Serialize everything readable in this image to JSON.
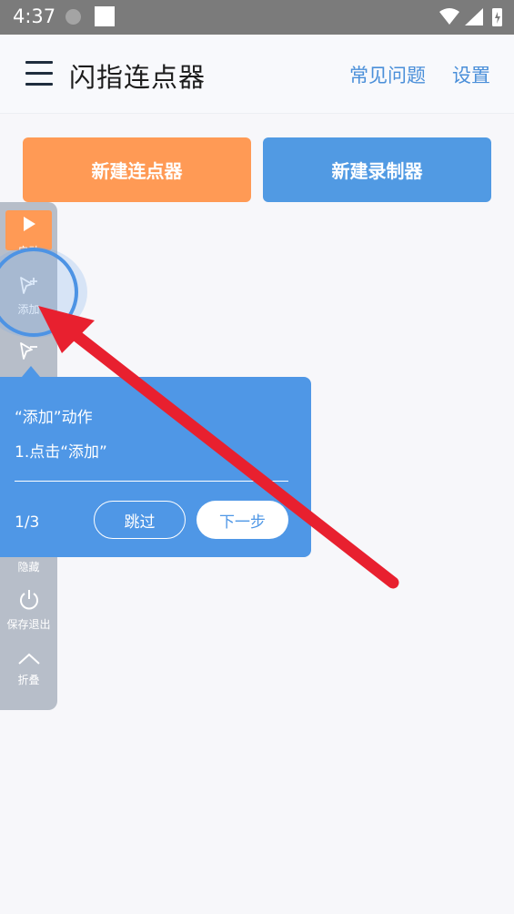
{
  "status_bar": {
    "time": "4:37"
  },
  "app_bar": {
    "title": "闪指连点器",
    "faq": "常见问题",
    "settings": "设置"
  },
  "actions": {
    "new_clicker": "新建连点器",
    "new_recorder": "新建录制器"
  },
  "float_panel": {
    "start": "启动",
    "add": "添加",
    "hide": "隐藏",
    "save_exit": "保存退出",
    "fold": "折叠"
  },
  "tooltip": {
    "title": "“添加”动作",
    "step": "1.点击“添加”",
    "page": "1/3",
    "skip": "跳过",
    "next": "下一步"
  },
  "colors": {
    "orange": "#ff9a55",
    "blue": "#519ae3",
    "tooltip_blue": "#4f97e6",
    "arrow_red": "#e8202f",
    "panel_gray": "#b7bec9"
  }
}
